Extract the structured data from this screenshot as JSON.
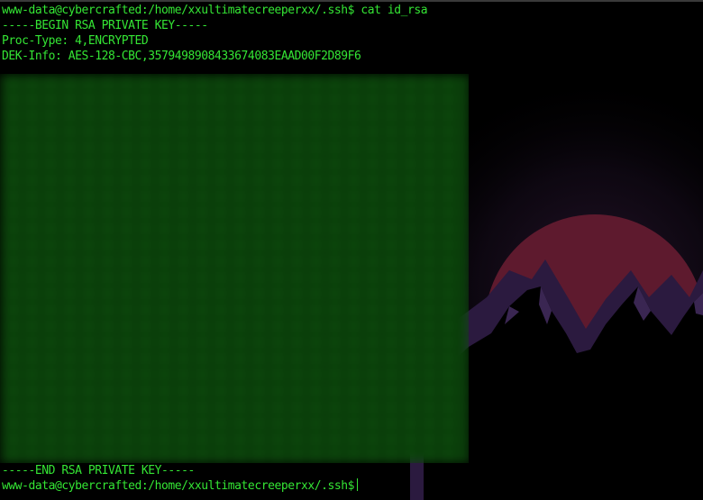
{
  "terminal": {
    "prompt_line_1": "www-data@cybercrafted:/home/xxultimatecreeperxx/.ssh$ cat id_rsa",
    "key_begin": "-----BEGIN RSA PRIVATE KEY-----",
    "proc_type": "Proc-Type: 4,ENCRYPTED",
    "dek_info": "DEK-Info: AES-128-CBC,3579498908433674083EAAD00F2D89F6",
    "key_end": "-----END RSA PRIVATE KEY-----",
    "prompt_line_2": "www-data@cybercrafted:/home/xxultimatecreeperxx/.ssh$"
  },
  "colors": {
    "terminal_text": "#34e534",
    "background": "#000000",
    "moon": "#5e1a2e",
    "mountain": "#2b1a3f"
  }
}
